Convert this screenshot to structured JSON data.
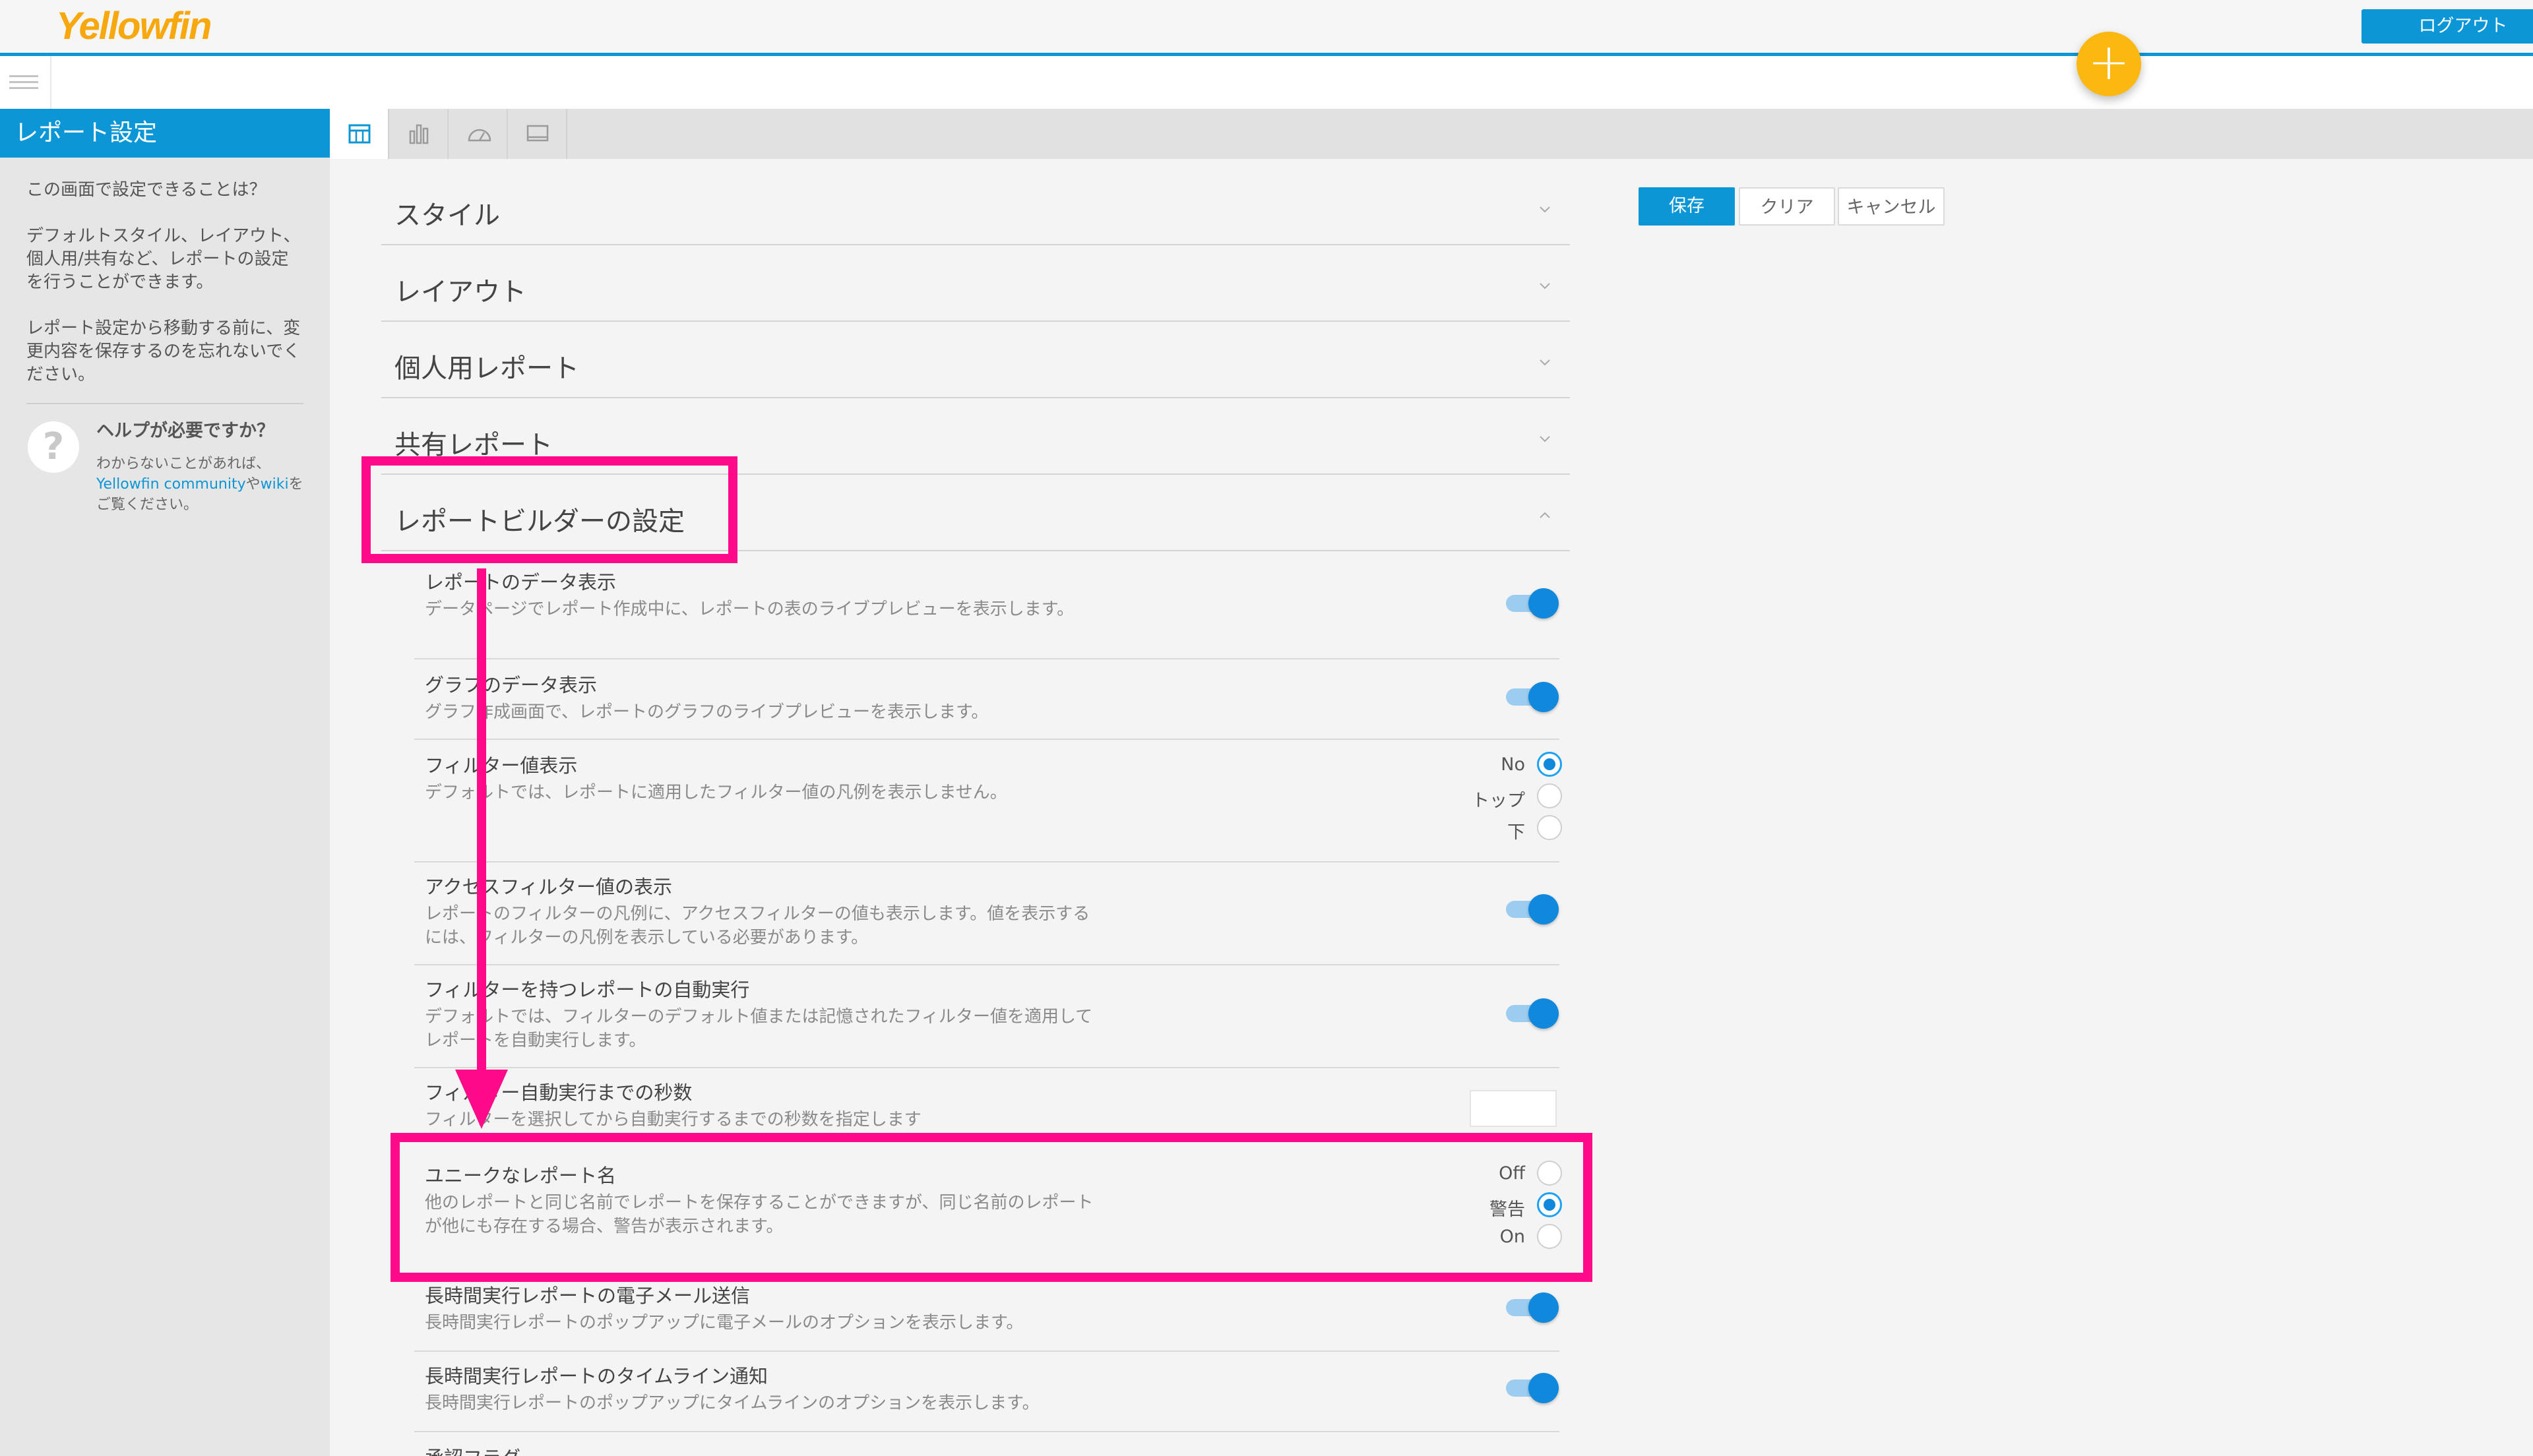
{
  "header": {
    "logo_text": "Yellowfin",
    "logout_label": "ログアウト",
    "fab_label": "+"
  },
  "sidebar": {
    "title": "レポート設定",
    "question": "この画面で設定できることは？",
    "description": "デフォルトスタイル、レイアウト、個人用/共有など、レポートの設定を行うことができます。",
    "reminder": "レポート設定から移動する前に、変更内容を保存するのを忘れないでください。",
    "help_title": "ヘルプが必要ですか？",
    "help_text_1": "わからないことがあれば、",
    "help_link_community": "Yellowfin community",
    "help_text_2": "や",
    "help_link_wiki": "wiki",
    "help_text_3": "をご覧ください。",
    "help_icon": "question-icon"
  },
  "tabs": [
    {
      "icon": "table-icon",
      "active": true
    },
    {
      "icon": "bar-chart-icon",
      "active": false
    },
    {
      "icon": "dashboard-gauge-icon",
      "active": false
    },
    {
      "icon": "presentation-icon",
      "active": false
    }
  ],
  "sections": [
    {
      "title": "スタイル",
      "expanded": false
    },
    {
      "title": "レイアウト",
      "expanded": false
    },
    {
      "title": "個人用レポート",
      "expanded": false
    },
    {
      "title": "共有レポート",
      "expanded": false
    },
    {
      "title": "レポートビルダーの設定",
      "expanded": true
    }
  ],
  "settings": {
    "data_display": {
      "title": "レポートのデータ表示",
      "desc": "データページでレポート作成中に、レポートの表のライブプレビューを表示します。",
      "value": "on"
    },
    "chart_data_display": {
      "title": "グラフのデータ表示",
      "desc": "グラフ作成画面で、レポートのグラフのライブプレビューを表示します。",
      "value": "on"
    },
    "filter_value_display": {
      "title": "フィルター値表示",
      "desc": "デフォルトでは、レポートに適用したフィルター値の凡例を表示しません。",
      "options": [
        "No",
        "トップ",
        "下"
      ],
      "selected": "No"
    },
    "access_filter_display": {
      "title": "アクセスフィルター値の表示",
      "desc": "レポートのフィルターの凡例に、アクセスフィルターの値も表示します。値を表示するには、フィルターの凡例を表示している必要があります。",
      "value": "on"
    },
    "auto_run_filters": {
      "title": "フィルターを持つレポートの自動実行",
      "desc": "デフォルトでは、フィルターのデフォルト値または記憶されたフィルター値を適用してレポートを自動実行します。",
      "value": "on"
    },
    "auto_run_seconds": {
      "title": "フィルター自動実行までの秒数",
      "desc": "フィルターを選択してから自動実行するまでの秒数を指定します",
      "value": ""
    },
    "unique_report_name": {
      "title": "ユニークなレポート名",
      "desc": "他のレポートと同じ名前でレポートを保存することができますが、同じ名前のレポートが他にも存在する場合、警告が表示されます。",
      "options": [
        "Off",
        "警告",
        "On"
      ],
      "selected": "警告"
    },
    "long_run_email": {
      "title": "長時間実行レポートの電子メール送信",
      "desc": "長時間実行レポートのポップアップに電子メールのオプションを表示します。",
      "value": "on"
    },
    "long_run_timeline": {
      "title": "長時間実行レポートのタイムライン通知",
      "desc": "長時間実行レポートのポップアップにタイムラインのオプションを表示します。",
      "value": "on"
    },
    "approval_flag": {
      "title": "承認フラグ"
    }
  },
  "actions": {
    "save_label": "保存",
    "clear_label": "クリア",
    "cancel_label": "キャンセル"
  },
  "colors": {
    "accent": "#0d96d6",
    "logo": "#f7a80f",
    "fab": "#fbb810",
    "highlight": "#ff0a89",
    "toggle_on": "#1088dc"
  }
}
